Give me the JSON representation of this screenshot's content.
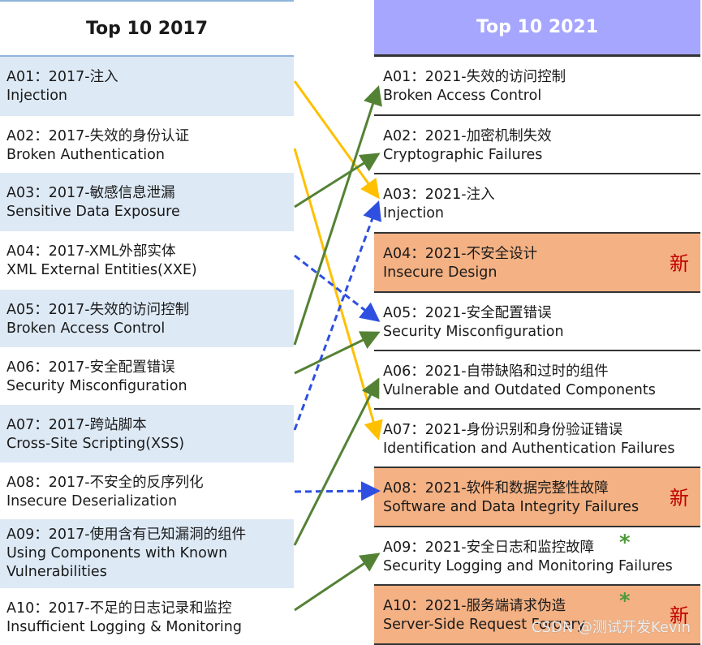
{
  "left": {
    "title": "Top 10 2017",
    "items": [
      {
        "cn": "A01：2017-注入",
        "en": "Injection"
      },
      {
        "cn": "A02：2017-失效的身份认证",
        "en": "Broken Authentication"
      },
      {
        "cn": "A03：2017-敏感信息泄漏",
        "en": "Sensitive Data Exposure"
      },
      {
        "cn": "A04：2017-XML外部实体",
        "en": "XML External Entities(XXE)"
      },
      {
        "cn": "A05：2017-失效的访问控制",
        "en": "Broken Access Control"
      },
      {
        "cn": "A06：2017-安全配置错误",
        "en": "Security Misconfiguration"
      },
      {
        "cn": "A07：2017-跨站脚本",
        "en": "Cross-Site Scripting(XSS)"
      },
      {
        "cn": "A08：2017-不安全的反序列化",
        "en": "Insecure Deserialization"
      },
      {
        "cn": "A09：2017-使用含有已知漏洞的组件",
        "en": "Using Components with Known Vulnerabilities"
      },
      {
        "cn": "A10：2017-不足的日志记录和监控",
        "en": "Insufficient Logging & Monitoring"
      }
    ]
  },
  "right": {
    "title": "Top 10 2021",
    "new_label": "新",
    "star": "*",
    "items": [
      {
        "cn": "A01：2021-失效的访问控制",
        "en": "Broken Access Control"
      },
      {
        "cn": "A02：2021-加密机制失效",
        "en": "Cryptographic Failures"
      },
      {
        "cn": "A03：2021-注入",
        "en": "Injection"
      },
      {
        "cn": "A04：2021-不安全设计",
        "en": "Insecure Design",
        "new": true
      },
      {
        "cn": "A05：2021-安全配置错误",
        "en": "Security Misconfiguration"
      },
      {
        "cn": "A06：2021-自带缺陷和过时的组件",
        "en": "Vulnerable and Outdated Components"
      },
      {
        "cn": "A07：2021-身份识别和身份验证错误",
        "en": "Identification and Authentication Failures"
      },
      {
        "cn": "A08：2021-软件和数据完整性故障",
        "en": "Software and Data Integrity Failures",
        "new": true
      },
      {
        "cn": "A09：2021-安全日志和监控故障",
        "en": "Security Logging and Monitoring Failures",
        "star": true
      },
      {
        "cn": "A10：2021-服务端请求伪造",
        "en": "Server-Side Request Forgery",
        "new": true,
        "star": true
      }
    ]
  },
  "colors": {
    "header_2021": "#a6a6ff",
    "row_2017": "#dde9f5",
    "new_row": "#f4b183",
    "new_text": "#c00000",
    "yellow": "#ffc000",
    "green": "#548235",
    "blue": "#2e4fe0"
  },
  "mappings": [
    {
      "from": "A01",
      "to": "A03",
      "style": "yellow"
    },
    {
      "from": "A02",
      "to": "A07",
      "style": "yellow"
    },
    {
      "from": "A03",
      "to": "A02",
      "style": "green"
    },
    {
      "from": "A04",
      "to": "A05",
      "style": "blue-dashed"
    },
    {
      "from": "A05",
      "to": "A01",
      "style": "green"
    },
    {
      "from": "A06",
      "to": "A05",
      "style": "green"
    },
    {
      "from": "A07",
      "to": "A03",
      "style": "blue-dashed"
    },
    {
      "from": "A08",
      "to": "A08",
      "style": "blue-dashed"
    },
    {
      "from": "A09",
      "to": "A06",
      "style": "green"
    },
    {
      "from": "A10",
      "to": "A09",
      "style": "green"
    }
  ],
  "watermark": "CSDN @测试开发Kevin"
}
